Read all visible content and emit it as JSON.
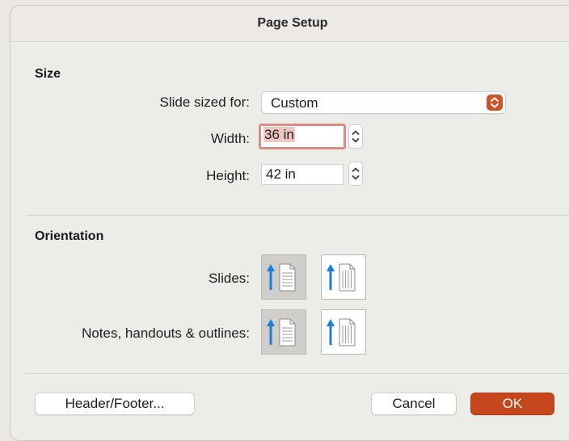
{
  "dialog": {
    "title": "Page Setup"
  },
  "size": {
    "section_title": "Size",
    "slide_sized_for": {
      "label": "Slide sized for:",
      "value": "Custom"
    },
    "width": {
      "label": "Width:",
      "value": "36 in"
    },
    "height": {
      "label": "Height:",
      "value": "42 in"
    }
  },
  "orientation": {
    "section_title": "Orientation",
    "slides": {
      "label": "Slides:",
      "selected": "portrait"
    },
    "notes": {
      "label": "Notes, handouts & outlines:",
      "selected": "portrait"
    }
  },
  "buttons": {
    "header_footer": "Header/Footer...",
    "cancel": "Cancel",
    "ok": "OK"
  },
  "colors": {
    "accent": "#c4481c",
    "arrow": "#1e7cdb",
    "focus_ring": "#d98c80"
  },
  "icons": {
    "popup": "up-down-chevron-icon",
    "stepper": "stepper-arrows-icon",
    "portrait": "portrait-page-icon",
    "landscape": "landscape-page-icon"
  }
}
